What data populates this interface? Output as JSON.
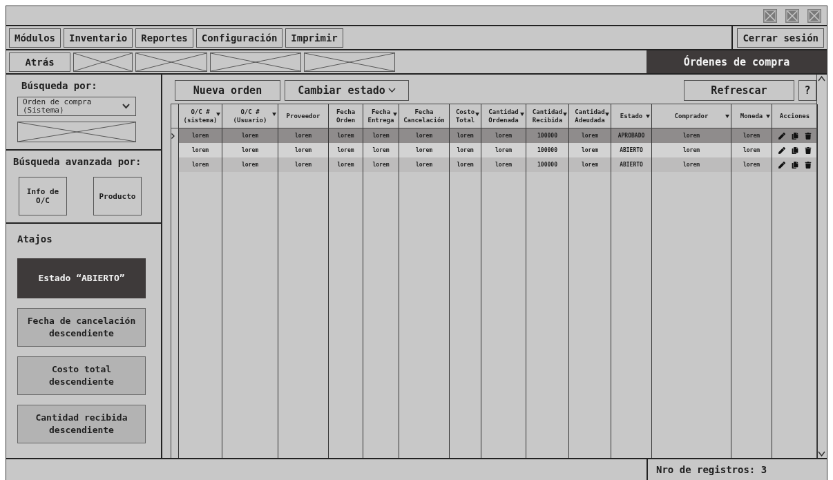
{
  "menu": [
    {
      "label": "Módulos"
    },
    {
      "label": "Inventario"
    },
    {
      "label": "Reportes"
    },
    {
      "label": "Configuración"
    },
    {
      "label": "Imprimir"
    }
  ],
  "logout": "Cerrar sesión",
  "nav": {
    "back": "Atrás",
    "page_title": "Órdenes de compra"
  },
  "sidebar": {
    "search_label": "Búsqueda por:",
    "search_select": "Orden de compra (Sistema)",
    "advanced_label": "Búsqueda avanzada por:",
    "advanced_buttons": [
      "Info de O/C",
      "Producto"
    ],
    "shortcuts_label": "Atajos",
    "shortcuts": [
      {
        "label": "Estado “ABIERTO”",
        "selected": true
      },
      {
        "label": "Fecha de cancelación descendiente",
        "selected": false
      },
      {
        "label": "Costo total descendiente",
        "selected": false
      },
      {
        "label": "Cantidad recibida descendiente",
        "selected": false
      }
    ]
  },
  "toolbar": {
    "new_order": "Nueva orden",
    "change_state": "Cambiar estado",
    "refresh": "Refrescar",
    "help": "?"
  },
  "table": {
    "columns": [
      {
        "label": "O/C #\n(sistema)",
        "sortable": true
      },
      {
        "label": "O/C #\n(Usuario)",
        "sortable": true
      },
      {
        "label": "Proveedor",
        "sortable": false
      },
      {
        "label": "Fecha\nOrden",
        "sortable": false
      },
      {
        "label": "Fecha\nEntrega",
        "sortable": true
      },
      {
        "label": "Fecha\nCancelación",
        "sortable": false
      },
      {
        "label": "Costo\nTotal",
        "sortable": true
      },
      {
        "label": "Cantidad\nOrdenada",
        "sortable": true
      },
      {
        "label": "Cantidad\nRecibida",
        "sortable": true
      },
      {
        "label": "Cantidad\nAdeudada",
        "sortable": true
      },
      {
        "label": "Estado",
        "sortable": true
      },
      {
        "label": "Comprador",
        "sortable": true
      },
      {
        "label": "Moneda",
        "sortable": true
      },
      {
        "label": "Acciones",
        "sortable": false
      }
    ],
    "rows": [
      {
        "selected": true,
        "cells": [
          "lorem",
          "lorem",
          "lorem",
          "lorem",
          "lorem",
          "lorem",
          "lorem",
          "lorem",
          "100000",
          "lorem",
          "APROBADO",
          "lorem",
          "lorem"
        ]
      },
      {
        "selected": false,
        "cells": [
          "lorem",
          "lorem",
          "lorem",
          "lorem",
          "lorem",
          "lorem",
          "lorem",
          "lorem",
          "100000",
          "lorem",
          "ABIERTO",
          "lorem",
          "lorem"
        ]
      },
      {
        "selected": false,
        "cells": [
          "lorem",
          "lorem",
          "lorem",
          "lorem",
          "lorem",
          "lorem",
          "lorem",
          "lorem",
          "100000",
          "lorem",
          "ABIERTO",
          "lorem",
          "lorem"
        ]
      }
    ]
  },
  "status_bar": {
    "count": "Nro de registros: 3"
  }
}
